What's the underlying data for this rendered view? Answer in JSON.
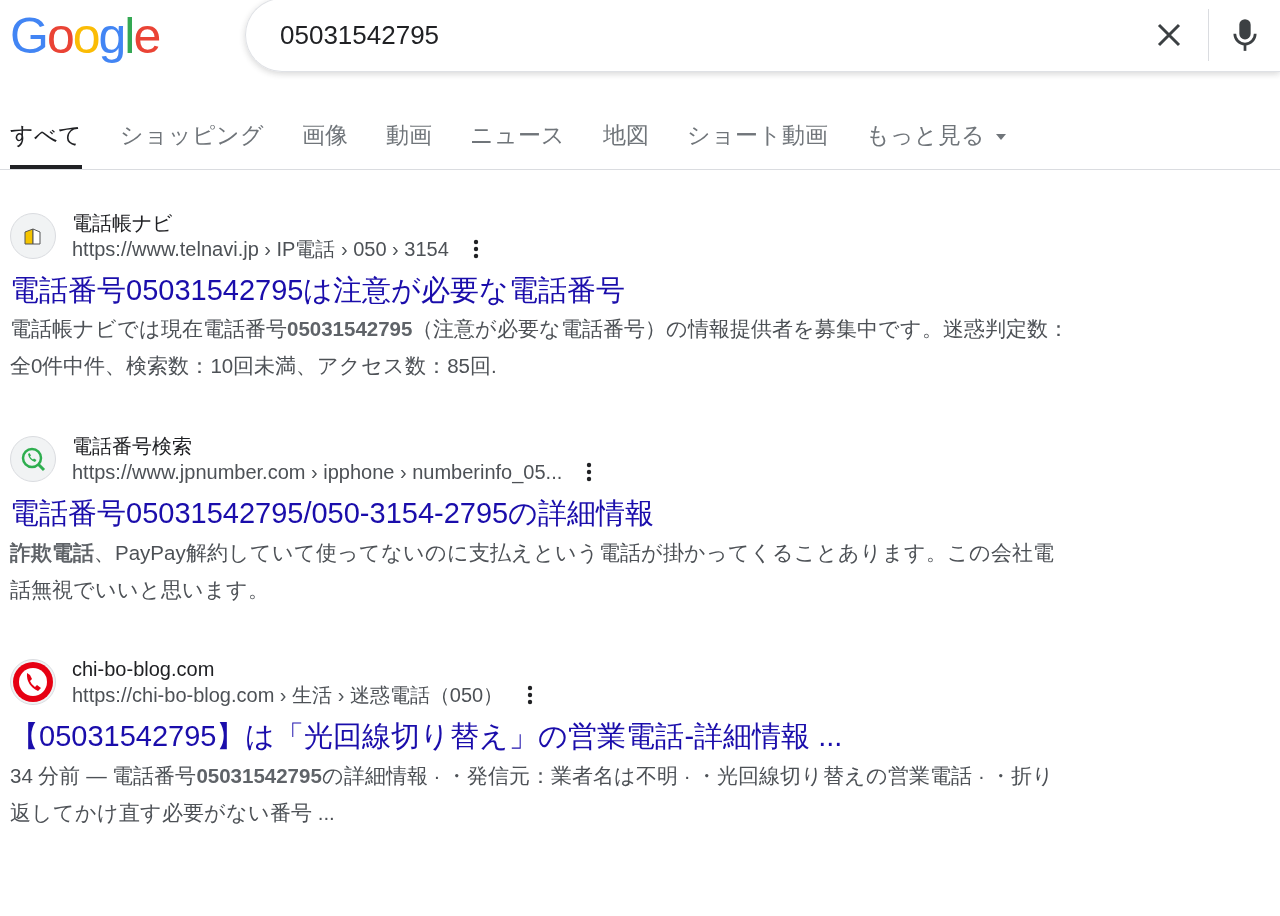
{
  "logo": "Google",
  "search": {
    "value": "05031542795"
  },
  "tabs": [
    {
      "label": "すべて",
      "selected": true,
      "dropdown": false
    },
    {
      "label": "ショッピング",
      "selected": false,
      "dropdown": false
    },
    {
      "label": "画像",
      "selected": false,
      "dropdown": false
    },
    {
      "label": "動画",
      "selected": false,
      "dropdown": false
    },
    {
      "label": "ニュース",
      "selected": false,
      "dropdown": false
    },
    {
      "label": "地図",
      "selected": false,
      "dropdown": false
    },
    {
      "label": "ショート動画",
      "selected": false,
      "dropdown": false
    },
    {
      "label": "もっと見る",
      "selected": false,
      "dropdown": true
    }
  ],
  "results": [
    {
      "site": "電話帳ナビ",
      "kind": "building",
      "url": "https://www.telnavi.jp › IP電話 › 050 › 3154",
      "title": "電話番号05031542795は注意が必要な電話番号",
      "snippet": "電話帳ナビでは現在電話番号**05031542795**（注意が必要な電話番号）の情報提供者を募集中です。迷惑判定数：全0件中件、検索数：10回未満、アクセス数：85回."
    },
    {
      "site": "電話番号検索",
      "kind": "search-phone",
      "url": "https://www.jpnumber.com › ipphone › numberinfo_05...",
      "title": "電話番号05031542795/050-3154-2795の詳細情報",
      "snippet": "**詐欺電話**、PayPay解約していて使ってないのに支払えという電話が掛かってくることあります。この会社電話無視でいいと思います。"
    },
    {
      "site": "chi-bo-blog.com",
      "kind": "phone",
      "url": "https://chi-bo-blog.com › 生活 › 迷惑電話（050）",
      "title": "【05031542795】は「光回線切り替え」の営業電話-詳細情報 ...",
      "snippet": "34 分前 — 電話番号**05031542795**の詳細情報 · ・発信元：業者名は不明 · ・光回線切り替えの営業電話 · ・折り返してかけ直す必要がない番号 ..."
    }
  ]
}
